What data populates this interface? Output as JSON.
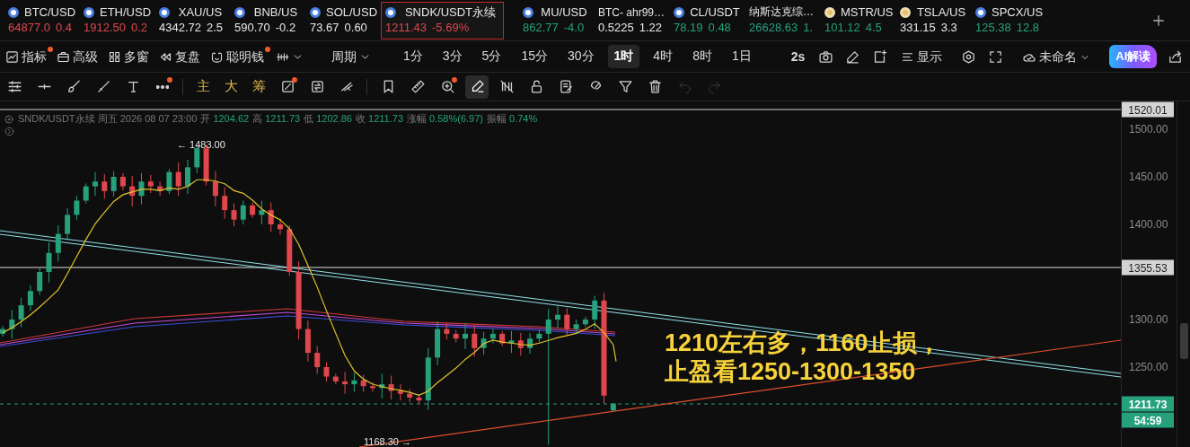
{
  "tickers": [
    {
      "symbol": "BTC/USD",
      "price": "64877.0",
      "change": "0.4",
      "color": "#e0474c",
      "kind": "coin",
      "selected": false
    },
    {
      "symbol": "ETH/USD",
      "price": "1912.50",
      "change": "0.2",
      "color": "#e0474c",
      "kind": "coin",
      "selected": false
    },
    {
      "symbol": "XAU/US",
      "price": "4342.72",
      "change": "2.5",
      "color": "#e8e8e8",
      "kind": "coin",
      "selected": false
    },
    {
      "symbol": "BNB/US",
      "price": "590.70",
      "change": "-0.2",
      "color": "#e8e8e8",
      "kind": "coin",
      "selected": false
    },
    {
      "symbol": "SOL/USD",
      "price": "73.67",
      "change": "0.60",
      "color": "#e8e8e8",
      "kind": "coin",
      "selected": false
    },
    {
      "symbol": "SNDK/USDT永续",
      "price": "1211.43",
      "change": "-5.69%",
      "color": "#e0474c",
      "kind": "coin",
      "selected": true
    },
    {
      "symbol": "MU/USD",
      "price": "862.77",
      "change": "-4.0",
      "color": "#26a17b",
      "kind": "coin",
      "selected": false
    },
    {
      "symbol": "BTC- ahr99…",
      "price": "0.5225",
      "change": "1.22",
      "color": "#e8e8e8",
      "kind": "plain",
      "selected": false
    },
    {
      "symbol": "CL/USDT",
      "price": "78.19",
      "change": "0.48",
      "color": "#26a17b",
      "kind": "coin",
      "selected": false
    },
    {
      "symbol": "纳斯达克综…",
      "price": "26628.63",
      "change": "1.",
      "color": "#26a17b",
      "kind": "plain",
      "selected": false
    },
    {
      "symbol": "MSTR/US",
      "price": "101.12",
      "change": "4.5",
      "color": "#26a17b",
      "kind": "stock",
      "selected": false
    },
    {
      "symbol": "TSLA/US",
      "price": "331.15",
      "change": "3.3",
      "color": "#e8e8e8",
      "kind": "stock",
      "selected": false
    },
    {
      "symbol": "SPCX/US",
      "price": "125.38",
      "change": "12.8",
      "color": "#26a17b",
      "kind": "coin",
      "selected": false
    }
  ],
  "toolbar": {
    "features": [
      {
        "label": "指标",
        "badge": true
      },
      {
        "label": "高级",
        "badge": false
      },
      {
        "label": "多窗",
        "badge": false
      },
      {
        "label": "复盘",
        "badge": false
      },
      {
        "label": "聪明钱",
        "badge": true
      }
    ],
    "period_menu": "周期",
    "intervals": [
      {
        "label": "1分",
        "selected": false
      },
      {
        "label": "3分",
        "selected": false
      },
      {
        "label": "5分",
        "selected": false
      },
      {
        "label": "15分",
        "selected": false
      },
      {
        "label": "30分",
        "selected": false
      },
      {
        "label": "1时",
        "selected": true
      },
      {
        "label": "4时",
        "selected": false
      },
      {
        "label": "8时",
        "selected": false
      },
      {
        "label": "1日",
        "selected": false
      }
    ],
    "refresh": "2s",
    "display": "显示",
    "layout_name": "未命名",
    "ai_button": "AI解读"
  },
  "draw_tools": [
    {
      "kind": "icon",
      "badge": false,
      "selected": false,
      "disabled": false
    },
    {
      "kind": "icon",
      "badge": false,
      "selected": false,
      "disabled": false
    },
    {
      "kind": "icon",
      "badge": false,
      "selected": false,
      "disabled": false
    },
    {
      "kind": "icon",
      "badge": false,
      "selected": false,
      "disabled": false
    },
    {
      "kind": "icon",
      "badge": false,
      "selected": false,
      "disabled": false
    },
    {
      "kind": "icon",
      "badge": true,
      "selected": false,
      "disabled": false
    },
    {
      "kind": "text",
      "label": "主",
      "badge": false,
      "selected": false,
      "disabled": false
    },
    {
      "kind": "text",
      "label": "大",
      "badge": false,
      "selected": false,
      "disabled": false
    },
    {
      "kind": "text",
      "label": "筹",
      "badge": false,
      "selected": false,
      "disabled": false
    },
    {
      "kind": "icon",
      "badge": true,
      "selected": false,
      "disabled": false
    },
    {
      "kind": "icon",
      "badge": false,
      "selected": false,
      "disabled": false
    },
    {
      "kind": "icon",
      "badge": false,
      "selected": false,
      "disabled": false
    },
    {
      "kind": "icon",
      "badge": false,
      "selected": false,
      "disabled": false
    },
    {
      "kind": "icon",
      "badge": false,
      "selected": false,
      "disabled": false
    },
    {
      "kind": "icon",
      "badge": true,
      "selected": false,
      "disabled": false
    },
    {
      "kind": "icon",
      "badge": false,
      "selected": true,
      "disabled": false
    },
    {
      "kind": "icon",
      "badge": false,
      "selected": false,
      "disabled": false
    },
    {
      "kind": "icon",
      "badge": false,
      "selected": false,
      "disabled": false
    },
    {
      "kind": "icon",
      "badge": false,
      "selected": false,
      "disabled": false
    },
    {
      "kind": "icon",
      "badge": false,
      "selected": false,
      "disabled": false
    },
    {
      "kind": "icon",
      "badge": false,
      "selected": false,
      "disabled": false
    },
    {
      "kind": "icon",
      "badge": false,
      "selected": false,
      "disabled": false
    },
    {
      "kind": "icon",
      "badge": false,
      "selected": false,
      "disabled": true
    },
    {
      "kind": "icon",
      "badge": false,
      "selected": false,
      "disabled": true
    }
  ],
  "info": {
    "symbol_time": "SNDK/USDT永续 周五 2026 08 07 23:00",
    "fields": [
      {
        "label": "开",
        "value": "1204.62"
      },
      {
        "label": "高",
        "value": "1211.73"
      },
      {
        "label": "低",
        "value": "1202.86"
      },
      {
        "label": "收",
        "value": "1211.73"
      },
      {
        "label": "涨幅",
        "value": "0.58%(6.97)"
      },
      {
        "label": "振幅",
        "value": "0.74%"
      }
    ]
  },
  "chart": {
    "high_label": "← 1483.00",
    "low_label": "1168.30 →",
    "annotation": [
      "1210左右多，1160止损，",
      "止盈看1250-1300-1350"
    ],
    "axis_ticks": [
      "1500.00",
      "1450.00",
      "1400.00",
      "1300.00",
      "1250.00"
    ],
    "price_tags": [
      {
        "kind": "line",
        "value": "1520.01"
      },
      {
        "kind": "line",
        "value": "1355.53"
      },
      {
        "kind": "last",
        "value": "1211.73"
      },
      {
        "kind": "timer",
        "value": "54:59"
      }
    ]
  }
}
